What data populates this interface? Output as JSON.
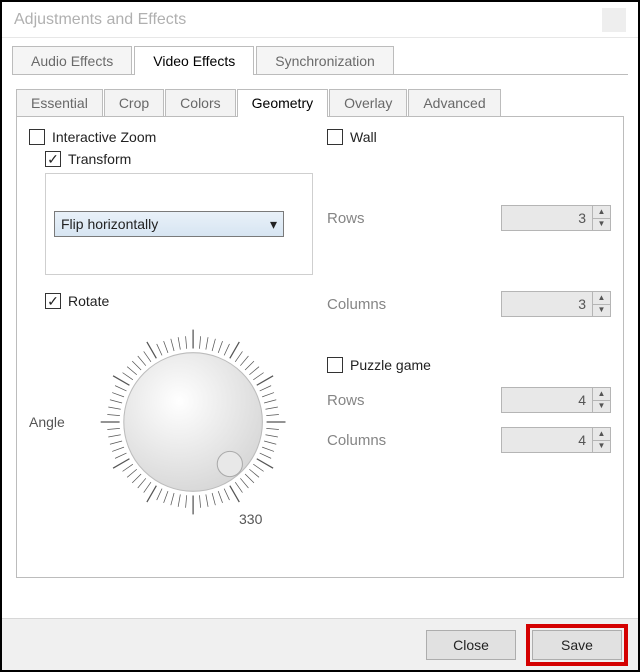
{
  "window": {
    "title": "Adjustments and Effects"
  },
  "primary_tabs": {
    "audio": "Audio Effects",
    "video": "Video Effects",
    "sync": "Synchronization",
    "active": "video"
  },
  "sub_tabs": {
    "essential": "Essential",
    "crop": "Crop",
    "colors": "Colors",
    "geometry": "Geometry",
    "overlay": "Overlay",
    "advanced": "Advanced",
    "active": "geometry"
  },
  "geometry": {
    "interactive_zoom": {
      "label": "Interactive Zoom",
      "checked": false
    },
    "transform": {
      "label": "Transform",
      "checked": true,
      "selected": "Flip horizontally"
    },
    "rotate": {
      "label": "Rotate",
      "checked": true,
      "angle_label": "Angle",
      "angle_readout": "330"
    },
    "wall": {
      "label": "Wall",
      "checked": false,
      "rows_label": "Rows",
      "rows_value": "3",
      "cols_label": "Columns",
      "cols_value": "3"
    },
    "puzzle": {
      "label": "Puzzle game",
      "checked": false,
      "rows_label": "Rows",
      "rows_value": "4",
      "cols_label": "Columns",
      "cols_value": "4"
    }
  },
  "buttons": {
    "close": "Close",
    "save": "Save"
  }
}
